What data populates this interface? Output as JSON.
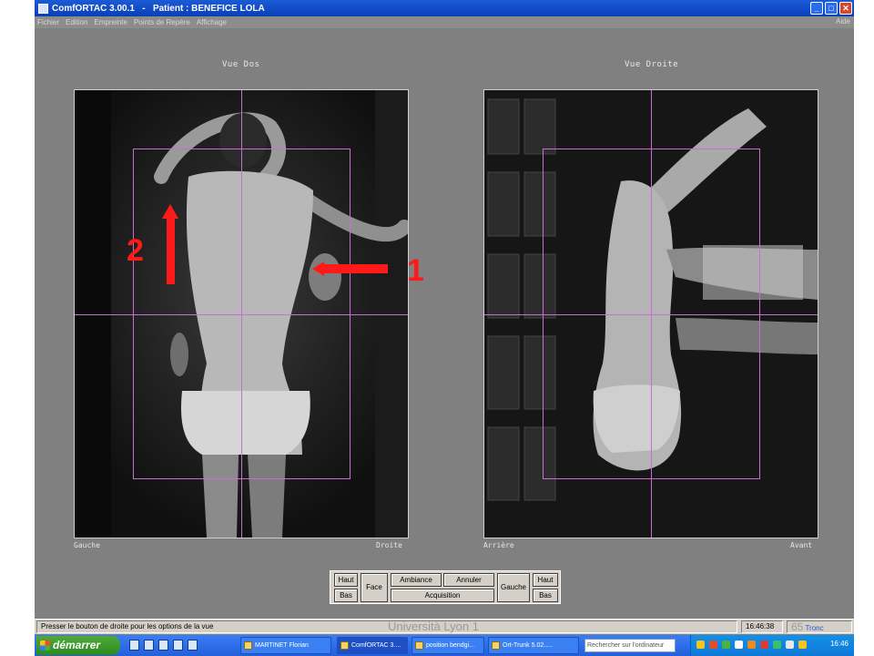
{
  "window": {
    "title": "ComfORTAC 3.00.1   -   Patient : BENEFICE LOLA",
    "minimize": "_",
    "maximize": "□",
    "close": "✕"
  },
  "menu": {
    "items": [
      "Fichier",
      "Edition",
      "Empreinte",
      "Points de Repère",
      "Affichage"
    ],
    "help": "Aide"
  },
  "views": {
    "left": {
      "title": "Vue Dos",
      "corner_left": "Gauche",
      "corner_right": "Droite"
    },
    "right": {
      "title": "Vue Droite",
      "corner_left": "Arrière",
      "corner_right": "Avant"
    }
  },
  "annotations": {
    "label_1": "1",
    "label_2": "2",
    "color": "#ff1a1a"
  },
  "controls": {
    "haut_left": "Haut",
    "bas_left": "Bas",
    "face": "Face",
    "ambiance": "Ambiance",
    "annuler": "Annuler",
    "acquisition": "Acquisition",
    "gauche": "Gauche",
    "haut_right": "Haut",
    "bas_right": "Bas"
  },
  "status": {
    "message": "Presser le bouton de droite pour les options de la vue",
    "watermark": "Università Lyon 1",
    "time": "16:46:38",
    "page": "65",
    "mode": "Tronc"
  },
  "taskbar": {
    "start": "démarrer",
    "items": [
      "MARTINET Florian",
      "ComfORTAC 3....",
      "position bendgi...",
      "Ort-Trunk 5.02....."
    ],
    "search_placeholder": "Rechercher sur l'ordinateur",
    "clock": "16:46"
  },
  "colors": {
    "window_bg": "#808080",
    "grid_line": "#c86ed0",
    "titlebar": "#0a3fb8"
  }
}
